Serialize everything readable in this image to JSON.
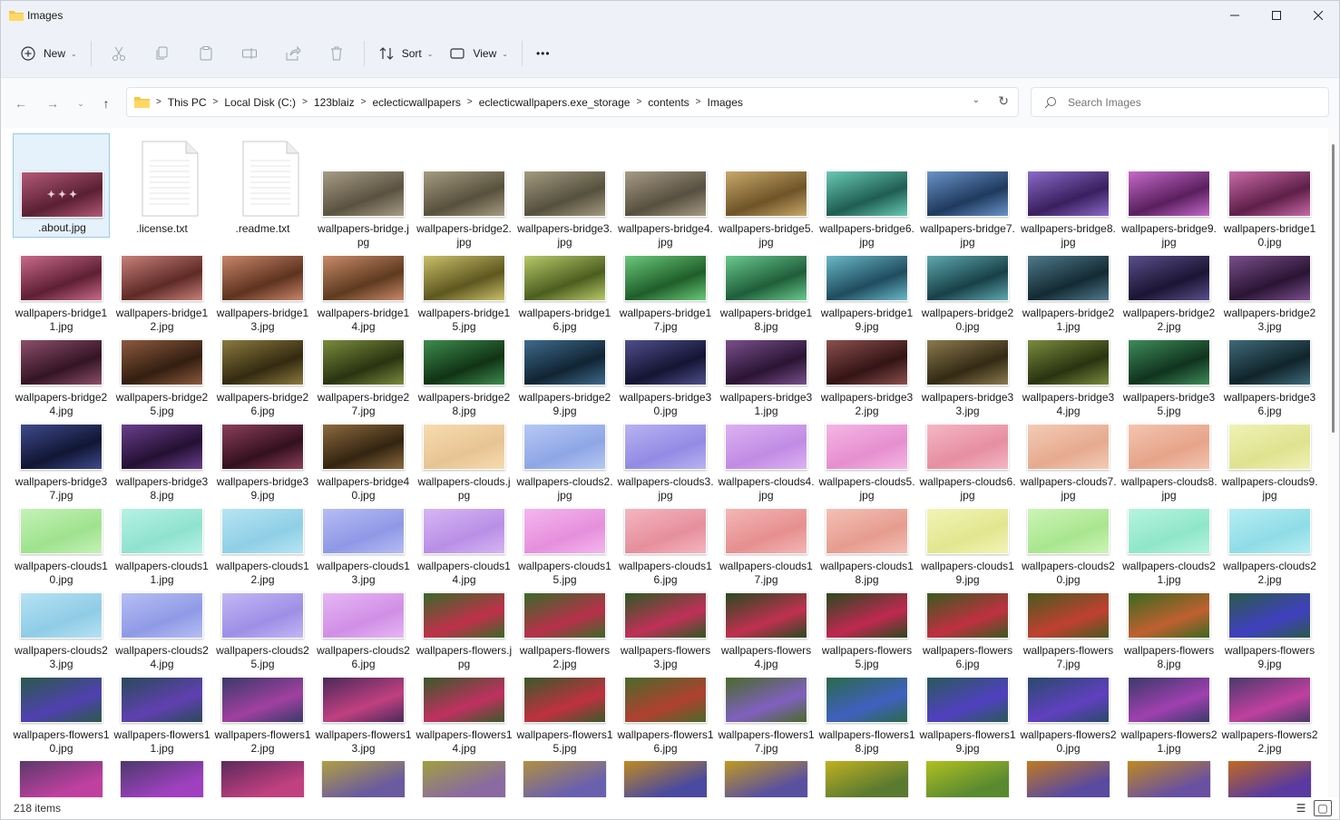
{
  "window": {
    "title": "Images"
  },
  "toolbar": {
    "new_label": "New",
    "sort_label": "Sort",
    "view_label": "View",
    "more_label": "•••"
  },
  "address": {
    "crumbs": [
      "This PC",
      "Local Disk (C:)",
      "123blaiz",
      "eclecticwallpapers",
      "eclecticwallpapers.exe_storage",
      "contents",
      "Images"
    ],
    "search_placeholder": "Search Images"
  },
  "status": {
    "count": "218 items"
  },
  "files": [
    {
      "name": ".about.jpg",
      "kind": "about",
      "colors": [
        "#b35a78",
        "#5a1f33"
      ]
    },
    {
      "name": ".license.txt",
      "kind": "doc"
    },
    {
      "name": ".readme.txt",
      "kind": "doc"
    },
    {
      "name": "wallpapers-bridge.jpg",
      "colors": [
        "#a79c86",
        "#5a5240"
      ]
    },
    {
      "name": "wallpapers-bridge2.jpg",
      "colors": [
        "#a69c82",
        "#57503c"
      ]
    },
    {
      "name": "wallpapers-bridge3.jpg",
      "colors": [
        "#a49a80",
        "#55503e"
      ]
    },
    {
      "name": "wallpapers-bridge4.jpg",
      "colors": [
        "#a79b85",
        "#574f3f"
      ]
    },
    {
      "name": "wallpapers-bridge5.jpg",
      "colors": [
        "#c9a86a",
        "#6e5428"
      ]
    },
    {
      "name": "wallpapers-bridge6.jpg",
      "colors": [
        "#6ac9b4",
        "#1f5e52"
      ]
    },
    {
      "name": "wallpapers-bridge7.jpg",
      "colors": [
        "#6a93c9",
        "#1f3a5e"
      ]
    },
    {
      "name": "wallpapers-bridge8.jpg",
      "colors": [
        "#8a6ac9",
        "#3a1f5e"
      ]
    },
    {
      "name": "wallpapers-bridge9.jpg",
      "colors": [
        "#c46ac9",
        "#5a1f5e"
      ]
    },
    {
      "name": "wallpapers-bridge10.jpg",
      "colors": [
        "#c96aa8",
        "#5e1f48"
      ]
    },
    {
      "name": "wallpapers-bridge11.jpg",
      "colors": [
        "#c96a8a",
        "#5e1f33"
      ]
    },
    {
      "name": "wallpapers-bridge12.jpg",
      "colors": [
        "#c9807a",
        "#5e2a26"
      ]
    },
    {
      "name": "wallpapers-bridge13.jpg",
      "colors": [
        "#c9856a",
        "#5e331f"
      ]
    },
    {
      "name": "wallpapers-bridge14.jpg",
      "colors": [
        "#c98a6a",
        "#5e3a1f"
      ]
    },
    {
      "name": "wallpapers-bridge15.jpg",
      "colors": [
        "#c9c06a",
        "#5e571f"
      ]
    },
    {
      "name": "wallpapers-bridge16.jpg",
      "colors": [
        "#b9c96a",
        "#4c5e1f"
      ]
    },
    {
      "name": "wallpapers-bridge17.jpg",
      "colors": [
        "#6ac97a",
        "#1f5e2a"
      ]
    },
    {
      "name": "wallpapers-bridge18.jpg",
      "colors": [
        "#6ac98e",
        "#1f5e3a"
      ]
    },
    {
      "name": "wallpapers-bridge19.jpg",
      "colors": [
        "#6ab9c9",
        "#1f4c5e"
      ]
    },
    {
      "name": "wallpapers-bridge20.jpg",
      "colors": [
        "#5fa9b0",
        "#184048"
      ]
    },
    {
      "name": "wallpapers-bridge21.jpg",
      "colors": [
        "#4f7a8c",
        "#132a33"
      ]
    },
    {
      "name": "wallpapers-bridge22.jpg",
      "colors": [
        "#5a4f8c",
        "#1c1433"
      ]
    },
    {
      "name": "wallpapers-bridge23.jpg",
      "colors": [
        "#7a4f8c",
        "#2a1433"
      ]
    },
    {
      "name": "wallpapers-bridge24.jpg",
      "colors": [
        "#8c4f6a",
        "#331424"
      ]
    },
    {
      "name": "wallpapers-bridge25.jpg",
      "colors": [
        "#8c5a3f",
        "#331e10"
      ]
    },
    {
      "name": "wallpapers-bridge26.jpg",
      "colors": [
        "#8c7a3f",
        "#332a10"
      ]
    },
    {
      "name": "wallpapers-bridge27.jpg",
      "colors": [
        "#7a8c3f",
        "#2a3310"
      ]
    },
    {
      "name": "wallpapers-bridge28.jpg",
      "colors": [
        "#3f8c4f",
        "#103314"
      ]
    },
    {
      "name": "wallpapers-bridge29.jpg",
      "colors": [
        "#3f6a8c",
        "#102433"
      ]
    },
    {
      "name": "wallpapers-bridge30.jpg",
      "colors": [
        "#4f4f8c",
        "#141433"
      ]
    },
    {
      "name": "wallpapers-bridge31.jpg",
      "colors": [
        "#7a4f8c",
        "#2a1433"
      ]
    },
    {
      "name": "wallpapers-bridge32.jpg",
      "colors": [
        "#8c4f4f",
        "#331414"
      ]
    },
    {
      "name": "wallpapers-bridge33.jpg",
      "colors": [
        "#8c7a4f",
        "#332a14"
      ]
    },
    {
      "name": "wallpapers-bridge34.jpg",
      "colors": [
        "#7a8c3f",
        "#2a3310"
      ]
    },
    {
      "name": "wallpapers-bridge35.jpg",
      "colors": [
        "#3f8c5a",
        "#10331e"
      ]
    },
    {
      "name": "wallpapers-bridge36.jpg",
      "colors": [
        "#3f6a7a",
        "#10242a"
      ]
    },
    {
      "name": "wallpapers-bridge37.jpg",
      "colors": [
        "#3f4a8c",
        "#101633"
      ]
    },
    {
      "name": "wallpapers-bridge38.jpg",
      "colors": [
        "#6a3f8c",
        "#241033"
      ]
    },
    {
      "name": "wallpapers-bridge39.jpg",
      "colors": [
        "#8c3f5a",
        "#33101e"
      ]
    },
    {
      "name": "wallpapers-bridge40.jpg",
      "colors": [
        "#8c6a3f",
        "#332410"
      ]
    },
    {
      "name": "wallpapers-clouds.jpg",
      "colors": [
        "#f6dcb0",
        "#e8c493"
      ]
    },
    {
      "name": "wallpapers-clouds2.jpg",
      "colors": [
        "#b6c8f4",
        "#8fa6e6"
      ]
    },
    {
      "name": "wallpapers-clouds3.jpg",
      "colors": [
        "#b9b2f2",
        "#928be4"
      ]
    },
    {
      "name": "wallpapers-clouds4.jpg",
      "colors": [
        "#dcb2f2",
        "#c18be4"
      ]
    },
    {
      "name": "wallpapers-clouds5.jpg",
      "colors": [
        "#f4b6e4",
        "#e68fcf"
      ]
    },
    {
      "name": "wallpapers-clouds6.jpg",
      "colors": [
        "#f4b6c4",
        "#e68fa1"
      ]
    },
    {
      "name": "wallpapers-clouds7.jpg",
      "colors": [
        "#f4cbb6",
        "#e6aa8f"
      ]
    },
    {
      "name": "wallpapers-clouds8.jpg",
      "colors": [
        "#f4c4b0",
        "#e6a48a"
      ]
    },
    {
      "name": "wallpapers-clouds9.jpg",
      "colors": [
        "#f0f2b6",
        "#dfe28f"
      ]
    },
    {
      "name": "wallpapers-clouds10.jpg",
      "colors": [
        "#c4f2b6",
        "#9fe28f"
      ]
    },
    {
      "name": "wallpapers-clouds11.jpg",
      "colors": [
        "#b6f2e4",
        "#8fe2cf"
      ]
    },
    {
      "name": "wallpapers-clouds12.jpg",
      "colors": [
        "#b6e4f4",
        "#8fcfe6"
      ]
    },
    {
      "name": "wallpapers-clouds13.jpg",
      "colors": [
        "#b6bcf4",
        "#8f98e6"
      ]
    },
    {
      "name": "wallpapers-clouds14.jpg",
      "colors": [
        "#d6b6f4",
        "#b98fe6"
      ]
    },
    {
      "name": "wallpapers-clouds15.jpg",
      "colors": [
        "#f4b6ee",
        "#e68fdc"
      ]
    },
    {
      "name": "wallpapers-clouds16.jpg",
      "colors": [
        "#f4b6c0",
        "#e68f9c"
      ]
    },
    {
      "name": "wallpapers-clouds17.jpg",
      "colors": [
        "#f4b6b6",
        "#e68f8f"
      ]
    },
    {
      "name": "wallpapers-clouds18.jpg",
      "colors": [
        "#f4c0b6",
        "#e69c8f"
      ]
    },
    {
      "name": "wallpapers-clouds19.jpg",
      "colors": [
        "#f2f4b6",
        "#e2e68f"
      ]
    },
    {
      "name": "wallpapers-clouds20.jpg",
      "colors": [
        "#cdf4b6",
        "#a9e68f"
      ]
    },
    {
      "name": "wallpapers-clouds21.jpg",
      "colors": [
        "#b6f4e0",
        "#8fe6c8"
      ]
    },
    {
      "name": "wallpapers-clouds22.jpg",
      "colors": [
        "#b6eef4",
        "#8fdce6"
      ]
    },
    {
      "name": "wallpapers-clouds23.jpg",
      "colors": [
        "#b6e2f4",
        "#8fcce6"
      ]
    },
    {
      "name": "wallpapers-clouds24.jpg",
      "colors": [
        "#b6bef4",
        "#8f9ae6"
      ]
    },
    {
      "name": "wallpapers-clouds25.jpg",
      "colors": [
        "#c2b6f4",
        "#9e8fe6"
      ]
    },
    {
      "name": "wallpapers-clouds26.jpg",
      "colors": [
        "#e6b6f4",
        "#d08fe6"
      ]
    },
    {
      "name": "wallpapers-flowers.jpg",
      "colors": [
        "#3a6a2a",
        "#c0304a"
      ]
    },
    {
      "name": "wallpapers-flowers2.jpg",
      "colors": [
        "#3a6a2a",
        "#b8304a"
      ]
    },
    {
      "name": "wallpapers-flowers3.jpg",
      "colors": [
        "#2f5a24",
        "#c03058"
      ]
    },
    {
      "name": "wallpapers-flowers4.jpg",
      "colors": [
        "#2a4a20",
        "#c03050"
      ]
    },
    {
      "name": "wallpapers-flowers5.jpg",
      "colors": [
        "#2a4a20",
        "#c02850"
      ]
    },
    {
      "name": "wallpapers-flowers6.jpg",
      "colors": [
        "#3a5a20",
        "#c03040"
      ]
    },
    {
      "name": "wallpapers-flowers7.jpg",
      "colors": [
        "#4a5a20",
        "#c04030"
      ]
    },
    {
      "name": "wallpapers-flowers8.jpg",
      "colors": [
        "#3a6a20",
        "#c06030"
      ]
    },
    {
      "name": "wallpapers-flowers9.jpg",
      "colors": [
        "#2a5a4a",
        "#4040c0"
      ]
    },
    {
      "name": "wallpapers-flowers10.jpg",
      "colors": [
        "#2a5a4a",
        "#5040b0"
      ]
    },
    {
      "name": "wallpapers-flowers11.jpg",
      "colors": [
        "#2a4a5a",
        "#6040b0"
      ]
    },
    {
      "name": "wallpapers-flowers12.jpg",
      "colors": [
        "#3a3a6a",
        "#a040a0"
      ]
    },
    {
      "name": "wallpapers-flowers13.jpg",
      "colors": [
        "#4a2a5a",
        "#c04080"
      ]
    },
    {
      "name": "wallpapers-flowers14.jpg",
      "colors": [
        "#3a5a2a",
        "#c03060"
      ]
    },
    {
      "name": "wallpapers-flowers15.jpg",
      "colors": [
        "#3a5a2a",
        "#c03040"
      ]
    },
    {
      "name": "wallpapers-flowers16.jpg",
      "colors": [
        "#4a6a2a",
        "#b04030"
      ]
    },
    {
      "name": "wallpapers-flowers17.jpg",
      "colors": [
        "#4a6a2a",
        "#8060c0"
      ]
    },
    {
      "name": "wallpapers-flowers18.jpg",
      "colors": [
        "#2a6a4a",
        "#4060c0"
      ]
    },
    {
      "name": "wallpapers-flowers19.jpg",
      "colors": [
        "#2a5a5a",
        "#5040c0"
      ]
    },
    {
      "name": "wallpapers-flowers20.jpg",
      "colors": [
        "#2a4a6a",
        "#6040c0"
      ]
    },
    {
      "name": "wallpapers-flowers21.jpg",
      "colors": [
        "#3a3a6a",
        "#a040b0"
      ]
    },
    {
      "name": "wallpapers-flowers22.jpg",
      "colors": [
        "#4a3a6a",
        "#c040a0"
      ]
    }
  ],
  "peek_colors": [
    [
      "#5a3a6a",
      "#c040a0"
    ],
    [
      "#4a3a6a",
      "#a040c0"
    ],
    [
      "#5a2a5a",
      "#c04080"
    ],
    [
      "#b0a040",
      "#6a5aa0"
    ],
    [
      "#a0a040",
      "#8a6aa0"
    ],
    [
      "#b09040",
      "#6a60b0"
    ],
    [
      "#c08a20",
      "#4a4aa0"
    ],
    [
      "#c09a20",
      "#5a50a0"
    ],
    [
      "#c0b020",
      "#5a7a30"
    ],
    [
      "#b0c020",
      "#5a8a30"
    ],
    [
      "#c07a20",
      "#5a4aa0"
    ],
    [
      "#c08a20",
      "#6a50a0"
    ],
    [
      "#c06a20",
      "#5a3aa0"
    ]
  ]
}
